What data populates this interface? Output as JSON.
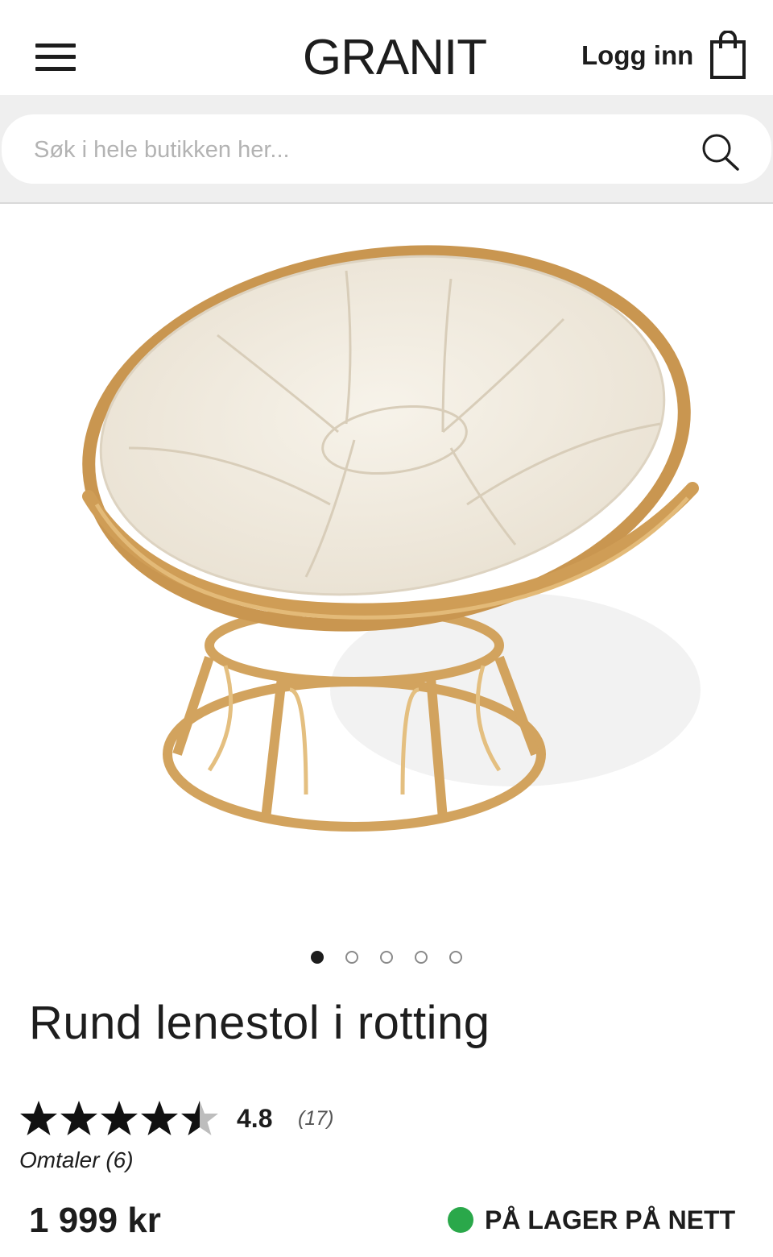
{
  "header": {
    "brand": "GRANIT",
    "login_label": "Logg inn"
  },
  "search": {
    "placeholder": "Søk i hele butikken her..."
  },
  "gallery": {
    "image_count": 5,
    "active_index": 0
  },
  "product": {
    "title": "Rund lenestol i rotting",
    "rating_value": "4.8",
    "rating_stars": 4.8,
    "rating_count": "(17)",
    "reviews_label": "Omtaler (6)",
    "price": "1 999 kr",
    "stock_label": "PÅ LAGER PÅ NETT"
  },
  "colors": {
    "text": "#1d1d1d",
    "search_band": "#efefef",
    "in_stock": "#2aa84a",
    "cushion": "#f3eee4",
    "rattan": "#d6a863"
  },
  "icons": [
    "hamburger-menu-icon",
    "shopping-bag-icon",
    "search-icon",
    "star-icon"
  ]
}
